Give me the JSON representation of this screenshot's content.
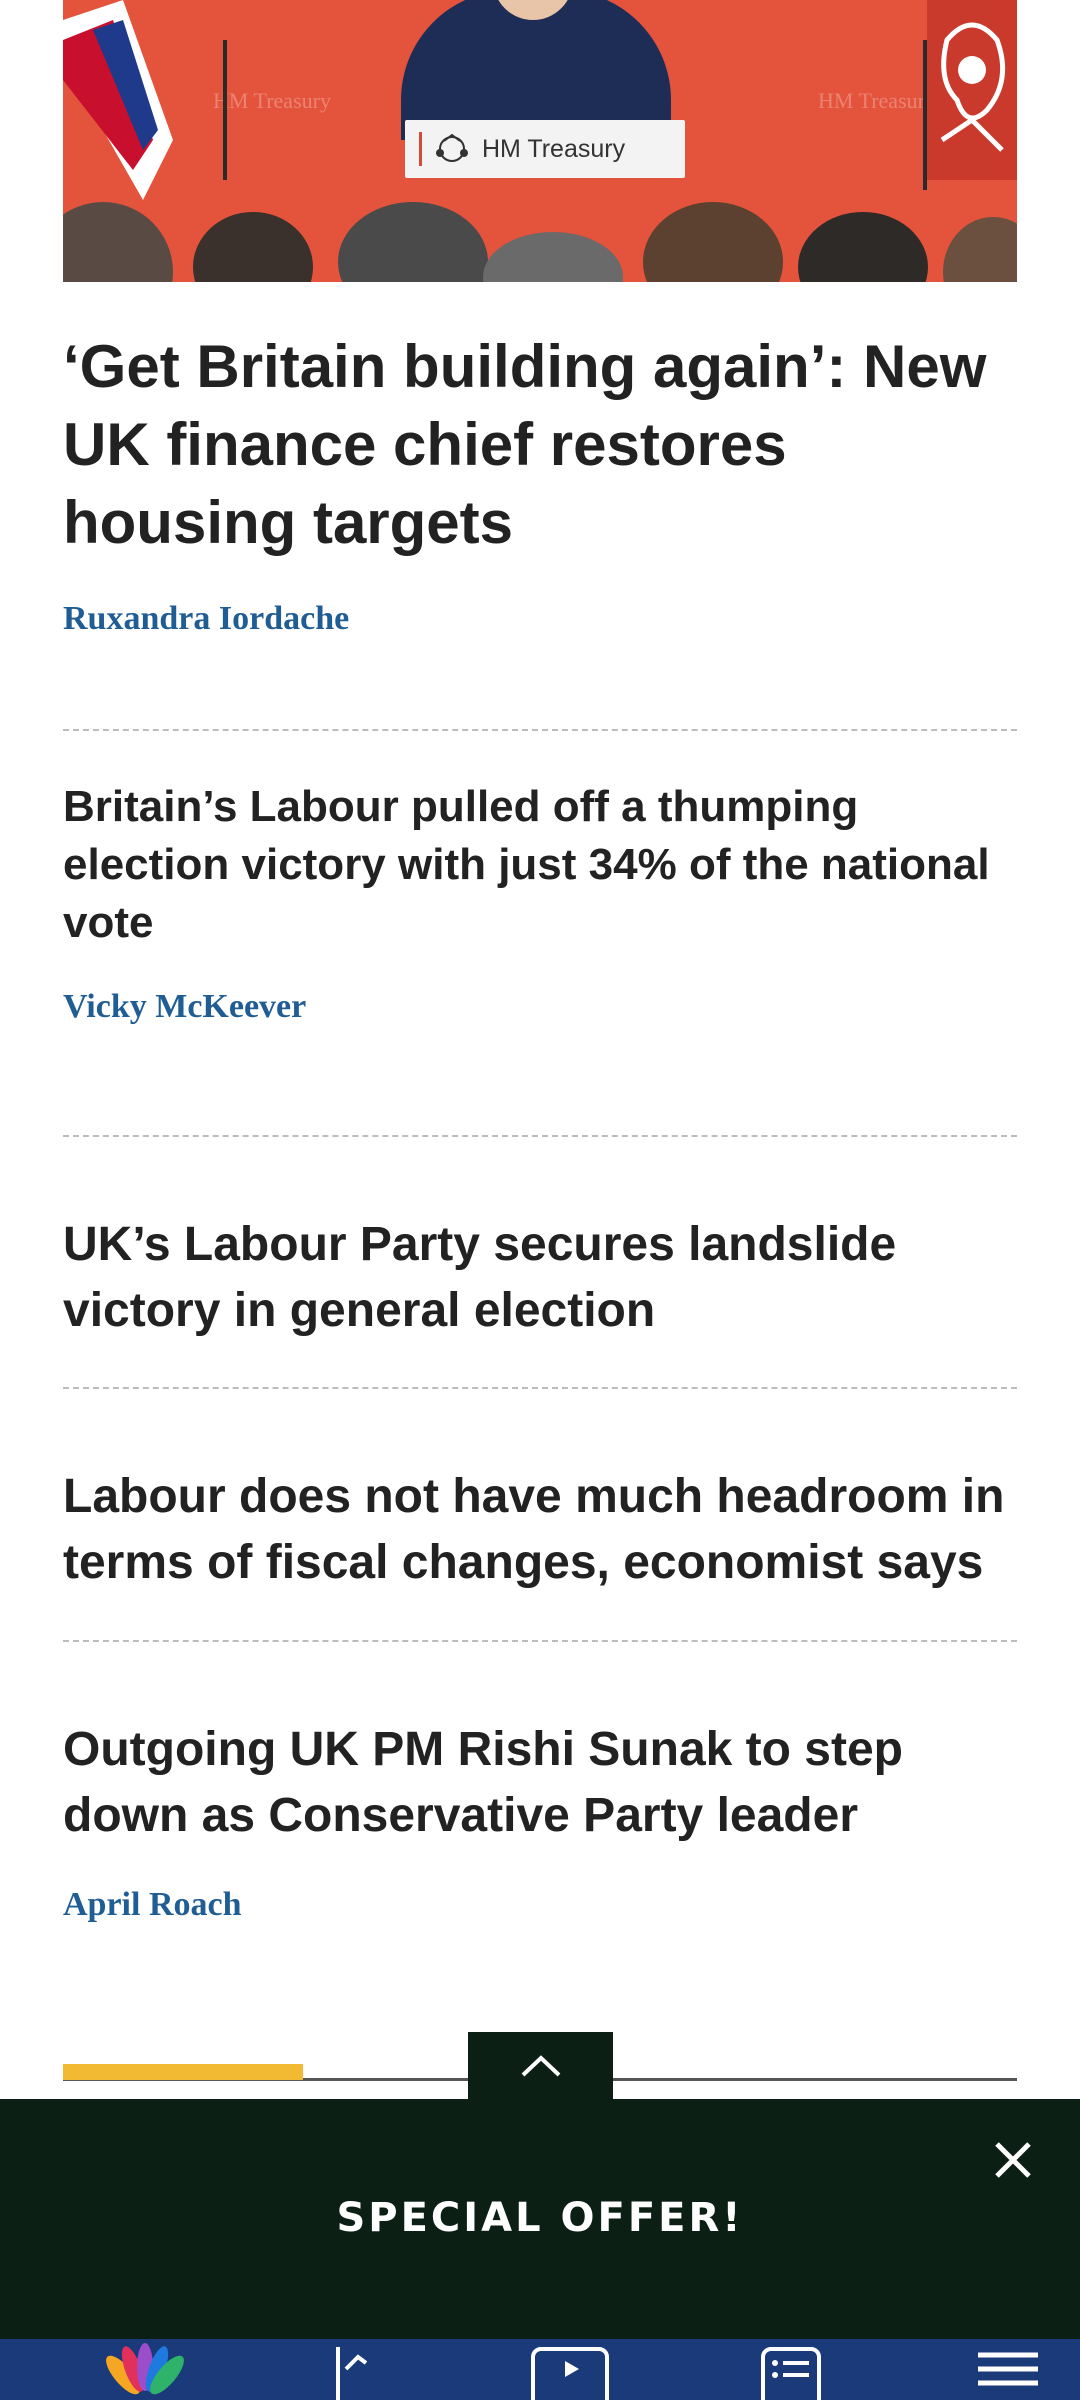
{
  "hero": {
    "podium_label": "HM Treasury",
    "watermark": "HM Treasury"
  },
  "articles": [
    {
      "headline": "‘Get Britain building again’: New UK finance chief restores housing targets",
      "author": "Ruxandra Iordache"
    },
    {
      "headline": "Britain’s Labour pulled off a thumping election victory with just 34% of the national vote",
      "author": "Vicky McKeever"
    },
    {
      "headline": "UK’s Labour Party secures landslide victory in general election"
    },
    {
      "headline": "Labour does not have much headroom in terms of fiscal changes, economist says"
    },
    {
      "headline": "Outgoing UK PM Rishi Sunak to step down as Conservative Party leader",
      "author": "April Roach"
    }
  ],
  "offer": {
    "title": "SPECIAL OFFER!"
  },
  "bottom_nav": {
    "icons": [
      "peacock-logo-icon",
      "markets-chart-icon",
      "video-icon",
      "watchlist-icon",
      "menu-icon"
    ]
  },
  "colors": {
    "author": "#1f5d94",
    "banner_bg": "#0c1f14",
    "progress_fill": "#f2b933",
    "nav_bg": "#1b3a7a",
    "hero_bg": "#e4533c"
  }
}
